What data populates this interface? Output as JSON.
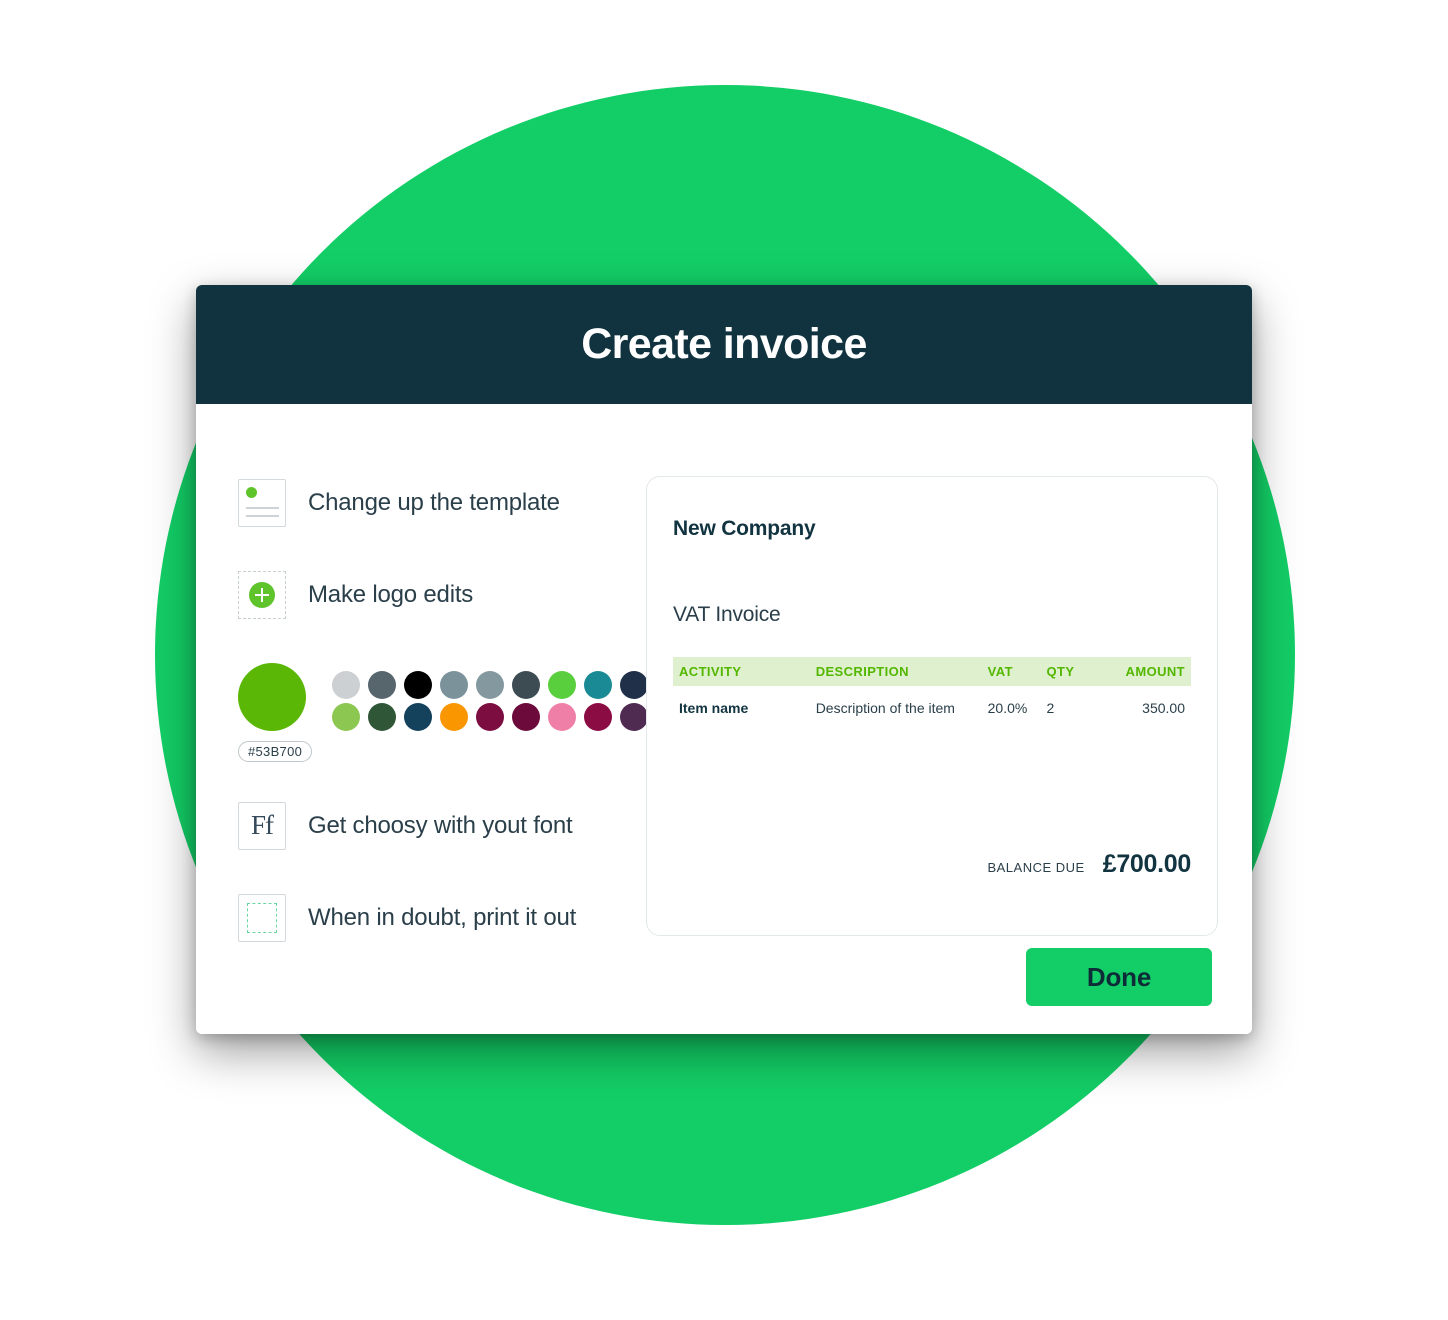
{
  "theme": {
    "backdrop_circle": "#13CE66",
    "header_bg": "#10333F",
    "accent_green": "#53B700",
    "table_header_bg": "#DFF0CE",
    "done_button_bg": "#13CE66",
    "text_dark": "#123440"
  },
  "header": {
    "title": "Create invoice"
  },
  "options": [
    {
      "icon": "template-card-icon",
      "label": "Change up the template"
    },
    {
      "icon": "add-logo-icon",
      "label": "Make logo edits"
    },
    {
      "icon": "font-Ff-icon",
      "label": "Get choosy with yout font"
    },
    {
      "icon": "print-crop-marks-icon",
      "label": "When in doubt, print it out"
    }
  ],
  "option_labels": {
    "template": "Change up the template",
    "logo": "Make logo edits",
    "font": "Get choosy with yout font",
    "print": "When in doubt, print it out"
  },
  "icon_glyphs": {
    "font": "Ff"
  },
  "color_picker": {
    "selected_hex": "#53B700",
    "selected_swatch_color": "#5BB705",
    "swatches_row1": [
      {
        "name": "light-gray",
        "color": "#CCD0D2"
      },
      {
        "name": "slate-gray",
        "color": "#57666C"
      },
      {
        "name": "black",
        "color": "#000000"
      },
      {
        "name": "blue-gray",
        "color": "#7B929B"
      },
      {
        "name": "steel-blue",
        "color": "#84999F"
      },
      {
        "name": "dark-slate",
        "color": "#3D4C52"
      },
      {
        "name": "bright-green",
        "color": "#5ACF3D"
      },
      {
        "name": "teal",
        "color": "#1A8A94"
      },
      {
        "name": "dark-navy",
        "color": "#1F3048"
      }
    ],
    "swatches_row2": [
      {
        "name": "light-green",
        "color": "#8CC751"
      },
      {
        "name": "forest-green",
        "color": "#2E5637"
      },
      {
        "name": "navy-blue",
        "color": "#14415C"
      },
      {
        "name": "orange",
        "color": "#FA9600"
      },
      {
        "name": "maroon",
        "color": "#7B0D40"
      },
      {
        "name": "dark-maroon",
        "color": "#6B0A3B"
      },
      {
        "name": "pink",
        "color": "#EF7FA6"
      },
      {
        "name": "wine",
        "color": "#8B0B43"
      },
      {
        "name": "purple",
        "color": "#4F2B52"
      }
    ]
  },
  "invoice_preview": {
    "company_name": "New Company",
    "invoice_type": "VAT Invoice",
    "columns": [
      "ACTIVITY",
      "DESCRIPTION",
      "VAT",
      "QTY",
      "AMOUNT"
    ],
    "rows": [
      {
        "activity": "Item name",
        "description": "Description of the item",
        "vat": "20.0%",
        "qty": "2",
        "amount": "350.00"
      }
    ],
    "balance_label": "BALANCE DUE",
    "balance_value": "£700.00"
  },
  "footer": {
    "done_label": "Done"
  }
}
